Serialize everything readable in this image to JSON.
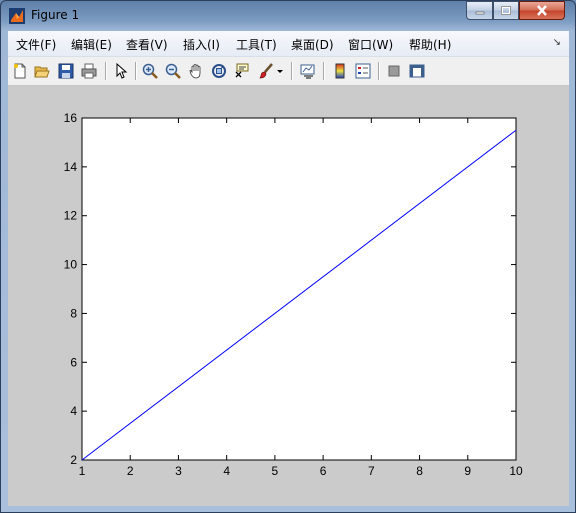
{
  "window": {
    "title": "Figure 1"
  },
  "menu": [
    {
      "label": "文件(F)"
    },
    {
      "label": "编辑(E)"
    },
    {
      "label": "查看(V)"
    },
    {
      "label": "插入(I)"
    },
    {
      "label": "工具(T)"
    },
    {
      "label": "桌面(D)"
    },
    {
      "label": "窗口(W)"
    },
    {
      "label": "帮助(H)"
    }
  ],
  "menu_overflow_icon": "double-chevron-icon",
  "toolbar": {
    "icons": [
      "new-figure-icon",
      "open-file-icon",
      "save-icon",
      "print-icon",
      "select-arrow-icon",
      "zoom-in-icon",
      "zoom-out-icon",
      "pan-hand-icon",
      "rotate-3d-icon",
      "data-cursor-icon",
      "brush-icon",
      "brush-dropdown-icon",
      "link-plot-icon",
      "colorbar-icon",
      "legend-icon",
      "hide-plot-tools-icon",
      "show-plot-tools-icon"
    ]
  },
  "colors": {
    "line": "#0000ff",
    "figure_bg": "#cbcbcb",
    "axes_bg": "#ffffff"
  },
  "chart_data": {
    "type": "line",
    "title": "",
    "xlabel": "",
    "ylabel": "",
    "xlim": [
      1,
      10
    ],
    "ylim": [
      2,
      16
    ],
    "xticks": [
      1,
      2,
      3,
      4,
      5,
      6,
      7,
      8,
      9,
      10
    ],
    "yticks": [
      2,
      4,
      6,
      8,
      10,
      12,
      14,
      16
    ],
    "grid": false,
    "series": [
      {
        "x": [
          1,
          10
        ],
        "y": [
          2,
          15.5
        ],
        "color": "#0000ff"
      }
    ]
  }
}
